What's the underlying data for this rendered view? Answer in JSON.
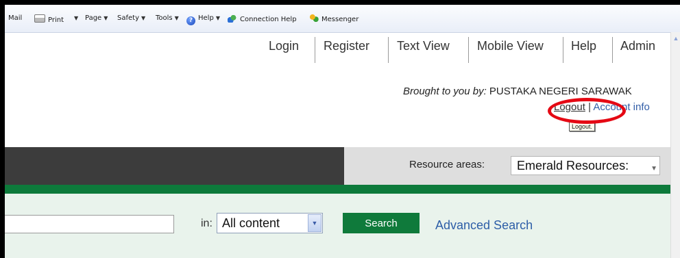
{
  "toolbar": {
    "mail": "Mail",
    "print": "Print",
    "page": "Page",
    "safety": "Safety",
    "tools": "Tools",
    "help": "Help",
    "connection_help": "Connection Help",
    "messenger": "Messenger"
  },
  "topnav": {
    "items": [
      "Login",
      "Register",
      "Text View",
      "Mobile View",
      "Help",
      "Admin"
    ]
  },
  "brought": {
    "prefix": "Brought to you by:",
    "org": "PUSTAKA NEGERI SARAWAK"
  },
  "account": {
    "logout": "Logout",
    "separator": "|",
    "account_info": "Account info",
    "tooltip": "Logout."
  },
  "resources": {
    "label": "Resource areas:",
    "selected": "Emerald Resources:"
  },
  "search": {
    "in_label": "in:",
    "scope_selected": "All content",
    "button": "Search",
    "advanced": "Advanced Search"
  },
  "colors": {
    "brand_green": "#0f7a3b",
    "link_blue": "#2d5ea7",
    "highlight_red": "#e50914"
  }
}
